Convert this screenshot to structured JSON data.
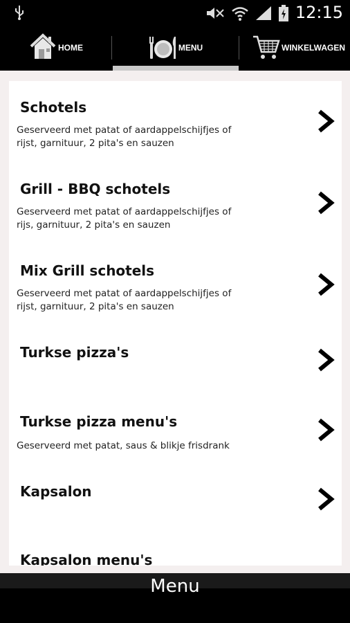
{
  "status_bar": {
    "time": "12:15",
    "icons": [
      "usb-icon",
      "mute-icon",
      "wifi-icon",
      "signal-icon",
      "battery-icon"
    ]
  },
  "nav": {
    "tabs": [
      {
        "label": "HOME",
        "icon": "home-icon"
      },
      {
        "label": "MENU",
        "icon": "plate-icon"
      },
      {
        "label": "WINKELWAGEN",
        "icon": "cart-icon"
      }
    ],
    "active": "MENU"
  },
  "menu_items": [
    {
      "title": "Schotels",
      "desc": "Geserveerd met patat of aardappelschijfjes of rijst, garnituur, 2 pita's en sauzen"
    },
    {
      "title": "Grill - BBQ schotels",
      "desc": "Geserveerd met patat of aardappelschijfjes of rijs, garnituur, 2 pita's en sauzen"
    },
    {
      "title": "Mix Grill schotels",
      "desc": "Geserveerd met patat of aardappelschijfjes of rijst, garnituur, 2 pita's en sauzen"
    },
    {
      "title": "Turkse pizza's",
      "desc": ""
    },
    {
      "title": "Turkse pizza menu's",
      "desc": "Geserveerd met patat, saus & blikje frisdrank"
    },
    {
      "title": "Kapsalon",
      "desc": ""
    },
    {
      "title": "Kapsalon menu's",
      "desc": ""
    }
  ],
  "footer": {
    "title": "Menu"
  }
}
